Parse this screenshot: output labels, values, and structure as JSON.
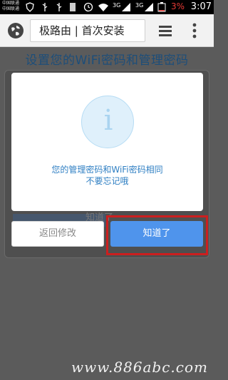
{
  "status_bar": {
    "carrier_line1": "中国联通",
    "carrier_line2": "中国联通",
    "network": "3G",
    "battery_percent": "3%",
    "time": "3:07"
  },
  "toolbar": {
    "url_text": "极路由 | 首次安装",
    "icons": [
      "globe-icon",
      "tabs-icon",
      "menu-icon"
    ]
  },
  "page": {
    "title": "设置您的WiFi密码和管理密码",
    "background_button_text": "知道了"
  },
  "dialog": {
    "icon": "info-icon",
    "message_line1": "您的管理密码和WiFi密码相同",
    "message_line2": "不要忘记哦"
  },
  "buttons": {
    "back_label": "返回修改",
    "ok_label": "知道了"
  },
  "watermark": "www.886abc.com",
  "colors": {
    "accent": "#4f94ec",
    "highlight": "#cc1f1f",
    "title": "#1d4e7a"
  }
}
